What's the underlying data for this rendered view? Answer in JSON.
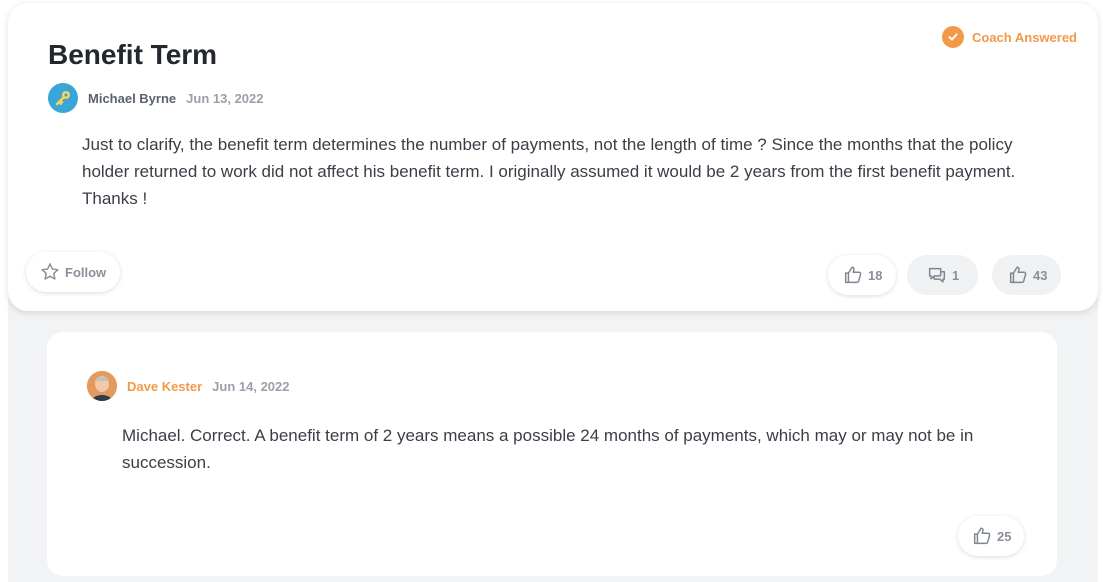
{
  "post": {
    "title": "Benefit Term",
    "badge": "Coach Answered",
    "author": "Michael Byrne",
    "date": "Jun 13, 2022",
    "body": "Just to clarify, the benefit term determines the number of payments, not the length of time ? Since the months that the policy holder returned to work did not affect his benefit term. I originally assumed it would be 2 years from the first benefit payment. Thanks !",
    "follow_label": "Follow",
    "likes": "18",
    "comments": "1",
    "helpful": "43"
  },
  "reply": {
    "author": "Dave Kester",
    "date": "Jun 14, 2022",
    "body": "Michael. Correct. A benefit term of 2 years means a possible 24 months of payments, which may or may not be in succession.",
    "likes": "25"
  },
  "colors": {
    "accent": "#f2994a",
    "key_avatar": "#3aa6d8",
    "background": "#f2f3f5"
  },
  "icons": [
    "check-circle-icon",
    "key-icon",
    "star-icon",
    "thumbs-up-icon",
    "comment-icon"
  ]
}
